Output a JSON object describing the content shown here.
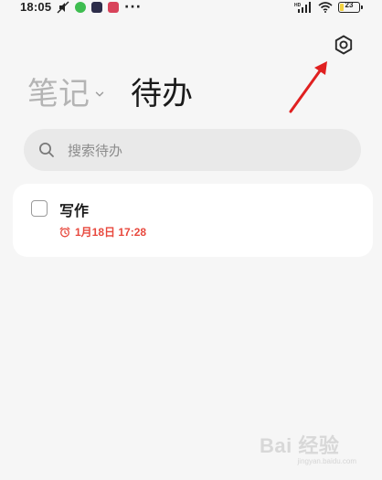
{
  "status_bar": {
    "time": "18:05",
    "more": "···",
    "battery_level": "23",
    "battery_fraction": 0.23
  },
  "icons": {
    "settings": "gear-icon",
    "search": "search-icon",
    "alarm": "alarm-clock-icon",
    "chevron": "chevron-down-icon"
  },
  "tabs": {
    "notes_label": "笔记",
    "todo_label": "待办"
  },
  "search": {
    "placeholder": "搜索待办"
  },
  "todos": [
    {
      "title": "写作",
      "reminder": "1月18日 17:28",
      "checked": false
    }
  ],
  "watermark": {
    "logo": "Bai 经验",
    "sub": "jingyan.baidu.com"
  },
  "colors": {
    "background": "#f6f6f6",
    "search_bg": "#e9e9e9",
    "reminder": "#e8493e",
    "inactive_tab": "#b4b4b4",
    "annotation_arrow": "#e02020"
  }
}
